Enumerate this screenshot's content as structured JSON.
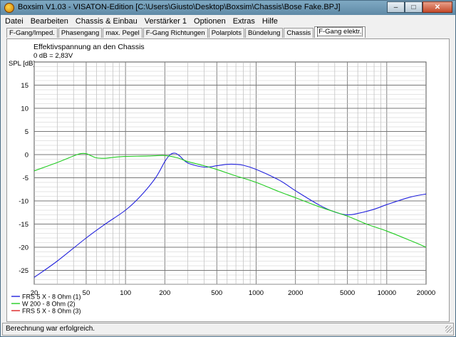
{
  "window": {
    "title": "Boxsim V1.03 - VISATON-Edition [C:\\Users\\Giusto\\Desktop\\Boxsim\\Chassis\\Bose Fake.BPJ]",
    "minimize_label": "–",
    "maximize_label": "□",
    "close_label": "✕"
  },
  "menu": [
    "Datei",
    "Bearbeiten",
    "Chassis & Einbau",
    "Verstärker 1",
    "Optionen",
    "Extras",
    "Hilfe"
  ],
  "tabs": [
    "F-Gang/Imped.",
    "Phasengang",
    "max. Pegel",
    "F-Gang Richtungen",
    "Polarplots",
    "Bündelung",
    "Chassis",
    "F-Gang elektr."
  ],
  "active_tab": "F-Gang elektr.",
  "chart": {
    "title": "Effektivspannung an den Chassis",
    "subtitle": "0 dB = 2,83V",
    "ylabel": "SPL [dB]"
  },
  "status": "Berechnung war erfolgreich.",
  "chart_data": {
    "type": "line",
    "x_scale": "log",
    "xlim": [
      20,
      20000
    ],
    "ylim": [
      -28,
      20
    ],
    "grid": true,
    "legend_placement": "bottom-left",
    "x_ticks": [
      20,
      50,
      100,
      200,
      500,
      1000,
      2000,
      5000,
      10000,
      20000
    ],
    "x_tick_labels": [
      "20",
      "50",
      "100",
      "200",
      "500",
      "1000",
      "2000",
      "5000",
      "10000",
      "20000"
    ],
    "y_ticks": [
      15,
      10,
      5,
      0,
      -5,
      -10,
      -15,
      -20,
      -25
    ],
    "y_tick_labels": [
      "15",
      "10",
      "5",
      "0",
      "-5",
      "-10",
      "-15",
      "-20",
      "-25"
    ],
    "series": [
      {
        "name": "FRS 5 X - 8 Ohm (1)",
        "color": "#2222dd",
        "x": [
          20,
          30,
          50,
          70,
          100,
          130,
          170,
          200,
          220,
          240,
          260,
          300,
          400,
          500,
          600,
          700,
          800,
          1000,
          1500,
          2000,
          3000,
          4000,
          5000,
          6000,
          8000,
          10000,
          15000,
          20000
        ],
        "y": [
          -26.5,
          -23,
          -18,
          -15,
          -12,
          -9,
          -5,
          -1.5,
          0,
          0.3,
          -0.3,
          -1.8,
          -2.7,
          -2.4,
          -2.1,
          -2.1,
          -2.3,
          -3.2,
          -5.5,
          -7.8,
          -10.8,
          -12.4,
          -13,
          -12.7,
          -11.8,
          -10.8,
          -9.2,
          -8.5
        ]
      },
      {
        "name": "W 200 - 8 Ohm (2)",
        "color": "#22cc22",
        "x": [
          20,
          30,
          40,
          45,
          50,
          55,
          60,
          70,
          80,
          100,
          150,
          200,
          250,
          300,
          400,
          500,
          700,
          1000,
          1500,
          2000,
          3000,
          5000,
          7000,
          10000,
          15000,
          20000
        ],
        "y": [
          -3.5,
          -1.7,
          -0.3,
          0.2,
          0.2,
          -0.3,
          -0.7,
          -0.8,
          -0.6,
          -0.4,
          -0.3,
          -0.2,
          -0.7,
          -1.5,
          -2.4,
          -3.2,
          -4.6,
          -6,
          -8,
          -9.3,
          -11.2,
          -13.3,
          -15,
          -16.5,
          -18.5,
          -20
        ]
      },
      {
        "name": "FRS 5 X - 8 Ohm (3)",
        "color": "#dd2222",
        "x": [],
        "y": []
      }
    ]
  }
}
